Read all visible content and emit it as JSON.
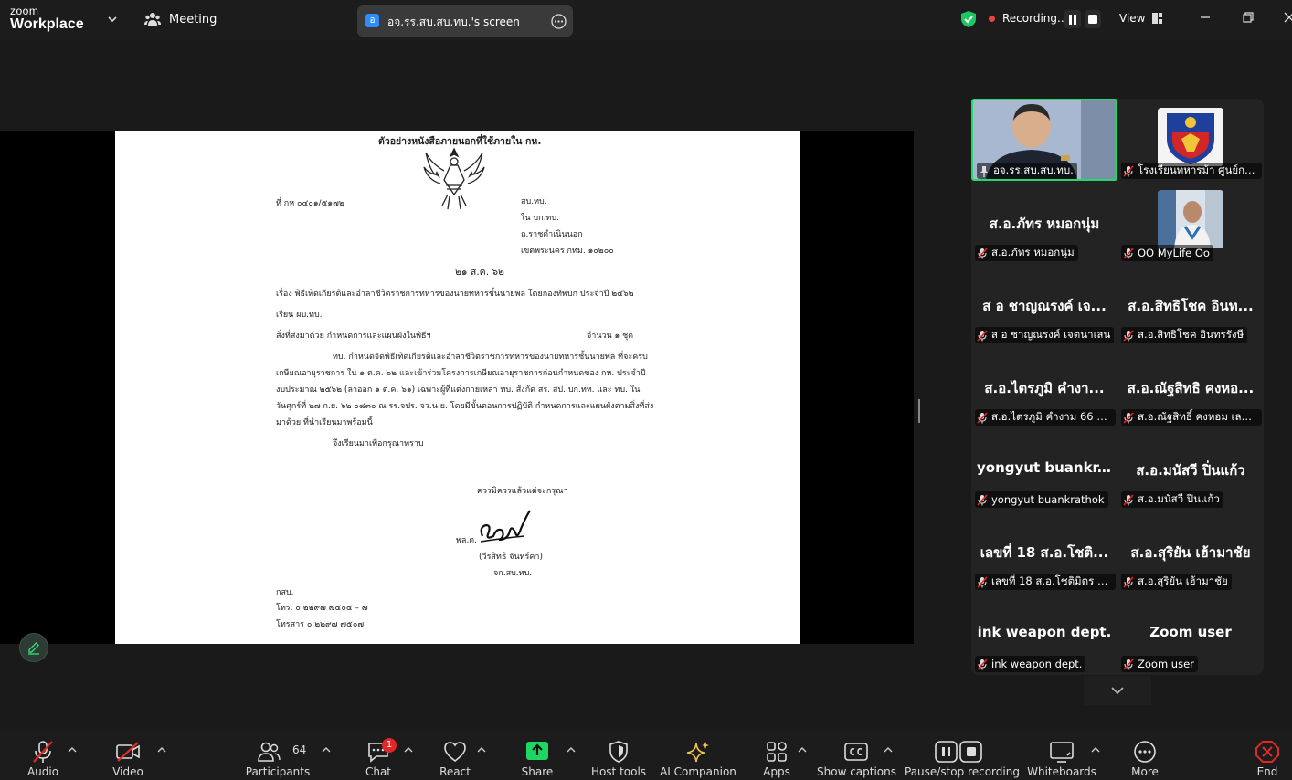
{
  "app": {
    "brand_top": "zoom",
    "brand_bottom": "Workplace",
    "meeting_label": "Meeting"
  },
  "screen_share": {
    "badge": "อ",
    "label": "อจ.รร.สบ.สบ.ทบ.'s screen"
  },
  "recording": {
    "status": "Recording...",
    "view_label": "View"
  },
  "colors": {
    "accent": "#2d8cff",
    "active_speaker": "#23d96b",
    "mute_red": "#e02828",
    "share_green": "#1ed760",
    "ai_gold": "#f2c14e"
  },
  "document": {
    "heading": "ตัวอย่างหนังสือภายนอกที่ใช้ภายใน กห.",
    "ref_no": "ที่  กห ๐๔๐๑/๕๑๗๒",
    "address": [
      "สบ.ทบ.",
      "ใน บก.ทบ.",
      "ถ.ราชดำเนินนอก",
      "เขตพระนคร กทม. ๑๐๒๐๐"
    ],
    "date": "๒๑ ส.ค. ๖๒",
    "subject": "เรื่อง  พิธีเทิดเกียรติและอำลาชีวิตราชการทหารของนายทหารชั้นนายพล โดยกองทัพบก ประจำปี ๒๕๖๒",
    "to": "เรียน  ผบ.ทบ.",
    "enclosure": "สิ่งที่ส่งมาด้วย  กำหนดการและแผนผังในพิธีฯ",
    "enclosure_count": "จำนวน ๑ ชุด",
    "body": [
      "ทบ. กำหนดจัดพิธีเทิดเกียรติและอำลาชีวิตราชการทหารของนายทหารชั้นนายพล ที่จะครบ",
      "เกษียณอายุราชการ ใน ๑ ต.ค. ๖๒ และเข้าร่วมโครงการเกษียณอายุราชการก่อนกำหนดของ กห. ประจำปี",
      "งบประมาณ ๒๕๖๒ (ลาออก ๑ ต.ค. ๖๑) เฉพาะผู้ที่แต่งกายเหล่า ทบ. สังกัด สร. สป. บก.ทท. และ ทบ. ใน",
      "วันศุกร์ที่ ๒๗ ก.ย. ๖๒ ๐๘๓๐ ณ รร.จปร. จว.น.ย. โดยมีขั้นตอนการปฏิบัติ กำหนดการและแผนผังตามสิ่งที่ส่ง",
      "มาด้วย ที่นำเรียนมาพร้อมนี้"
    ],
    "closing_request": "จึงเรียนมาเพื่อกรุณาทราบ",
    "courtesy": "ควรมิควรแล้วแต่จะกรุณา",
    "rank": "พล.ต.",
    "signer_name": "(วีรสิทธิ  จันทร์คา)",
    "signer_title": "จก.สบ.ทบ.",
    "office": "กสบ.",
    "tel": "โทร. ๐ ๒๒๙๗ ๗๕๐๕ – ๗",
    "fax": "โทรสาร ๐ ๒๒๙๗ ๗๕๐๗"
  },
  "gallery": [
    {
      "display": "",
      "label": "อจ.รร.สบ.สบ.ทบ.",
      "pinned": true,
      "video": true
    },
    {
      "display": "",
      "label": "โรงเรียนทหารม้า ศูนย์การ...",
      "video": true
    },
    {
      "display": "ส.อ.ภัทร  หมอกนุ่ม",
      "label": "ส.อ.ภัทร  หมอกนุ่ม"
    },
    {
      "display": "",
      "label": "OO MyLife Oo",
      "video": true
    },
    {
      "display": "ส อ ชาญณรงค์  เจ...",
      "label": "ส อ ชาญณรงค์ เจตนาเสน"
    },
    {
      "display": "ส.อ.สิทธิโชค อินท...",
      "label": "ส.อ.สิทธิโชค อินทรรังษี"
    },
    {
      "display": "ส.อ.ไตรภูมิ คำงา...",
      "label": "ส.อ.ไตรภูมิ คำงาม 66 ร้อ..."
    },
    {
      "display": "ส.อ.ณัฐสิทธิ คงหอ...",
      "label": "ส.อ.ณัฐสิทธิ์ คงหอม เลข..."
    },
    {
      "display": "yongyut  buankr...",
      "label": "yongyut buankrathok"
    },
    {
      "display": "ส.อ.มนัสวี ปิ่นแก้ว",
      "label": "ส.อ.มนัสวี ปิ่นแก้ว"
    },
    {
      "display": "เลขที่ 18 ส.อ.โชติ...",
      "label": "เลขที่ 18 ส.อ.โชติมิตร พ..."
    },
    {
      "display": "ส.อ.สุริยัน  เฮ้ามาชัย",
      "label": "ส.อ.สุริยัน  เฮ้ามาชัย"
    },
    {
      "display": "ink weapon dept.",
      "label": "ink weapon dept."
    },
    {
      "display": "Zoom user",
      "label": "Zoom user"
    }
  ],
  "toolbar": {
    "audio": "Audio",
    "video": "Video",
    "participants": "Participants",
    "participants_count": "64",
    "chat": "Chat",
    "chat_badge": "1",
    "react": "React",
    "share": "Share",
    "host_tools": "Host tools",
    "ai_companion": "AI Companion",
    "apps": "Apps",
    "captions": "Show captions",
    "recording": "Pause/stop recording",
    "whiteboards": "Whiteboards",
    "more": "More",
    "end": "End"
  }
}
